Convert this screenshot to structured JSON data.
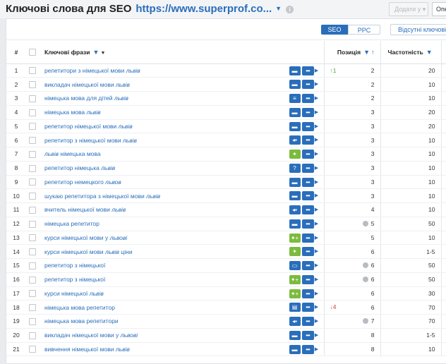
{
  "header": {
    "title": "Ключові слова для SEO",
    "url": "https://www.superprof.co...",
    "add_button": "Додати у",
    "ope_button": "Опе"
  },
  "toolbar": {
    "seo": "SEO",
    "ppc": "PPC",
    "hidden_button": "Відсутні ключові с"
  },
  "columns": {
    "num": "#",
    "keyword": "Ключові фрази",
    "position": "Позиція",
    "frequency": "Частотність"
  },
  "rows": [
    {
      "n": "1",
      "pre": "репетитори з німецької мови ",
      "it": "львів",
      "post": "",
      "i1": "chat",
      "c1": "blue",
      "tr": "↑1",
      "tc": "up",
      "dot": false,
      "pos": "2",
      "freq": "20"
    },
    {
      "n": "2",
      "pre": "викладач німецької мови ",
      "it": "львів",
      "post": "",
      "i1": "chat",
      "c1": "blue",
      "tr": "",
      "tc": "",
      "dot": false,
      "pos": "2",
      "freq": "10"
    },
    {
      "n": "3",
      "pre": "німецька мова для дітей ",
      "it": "львів",
      "post": "",
      "i1": "list",
      "c1": "blue",
      "tr": "",
      "tc": "",
      "dot": false,
      "pos": "2",
      "freq": "10"
    },
    {
      "n": "4",
      "pre": "німецька мова ",
      "it": "львів",
      "post": "",
      "i1": "chat",
      "c1": "blue",
      "tr": "",
      "tc": "",
      "dot": false,
      "pos": "3",
      "freq": "20"
    },
    {
      "n": "5",
      "pre": "репетитор німецької мови ",
      "it": "львів",
      "post": "",
      "i1": "chat",
      "c1": "blue",
      "tr": "",
      "tc": "",
      "dot": false,
      "pos": "3",
      "freq": "20"
    },
    {
      "n": "6",
      "pre": "репетитор з німецької мови ",
      "it": "львів",
      "post": "",
      "i1": "sign",
      "c1": "blue",
      "tr": "",
      "tc": "",
      "dot": false,
      "pos": "3",
      "freq": "10"
    },
    {
      "n": "7",
      "pre": "",
      "it": "львів",
      "post": " німецька мова",
      "i1": "sparkle",
      "c1": "green",
      "tr": "",
      "tc": "",
      "dot": false,
      "pos": "3",
      "freq": "10"
    },
    {
      "n": "8",
      "pre": "репетитор німецька ",
      "it": "львів",
      "post": "",
      "i1": "question",
      "c1": "blue",
      "tr": "",
      "tc": "",
      "dot": false,
      "pos": "3",
      "freq": "10"
    },
    {
      "n": "9",
      "pre": "репетитор немецкого ",
      "it": "львов",
      "post": "",
      "i1": "chat",
      "c1": "blue",
      "tr": "",
      "tc": "",
      "dot": false,
      "pos": "3",
      "freq": "10"
    },
    {
      "n": "10",
      "pre": "шукаю репетитора з німецької мови ",
      "it": "львів",
      "post": "",
      "i1": "chat",
      "c1": "blue",
      "tr": "",
      "tc": "",
      "dot": false,
      "pos": "3",
      "freq": "10"
    },
    {
      "n": "11",
      "pre": "вчитель німецької мови ",
      "it": "львів",
      "post": "",
      "i1": "sign",
      "c1": "blue",
      "tr": "",
      "tc": "",
      "dot": false,
      "pos": "4",
      "freq": "10"
    },
    {
      "n": "12",
      "pre": "німецька репетитор",
      "it": "",
      "post": "",
      "i1": "chat",
      "c1": "blue",
      "tr": "",
      "tc": "",
      "dot": true,
      "pos": "5",
      "freq": "50"
    },
    {
      "n": "13",
      "pre": "курси німецької мови у ",
      "it": "львові",
      "post": "",
      "i1": "sparkles",
      "c1": "green",
      "tr": "",
      "tc": "",
      "dot": false,
      "pos": "5",
      "freq": "10"
    },
    {
      "n": "14",
      "pre": "курси німецької мови ",
      "it": "львів",
      "post": " ціни",
      "i1": "sparkle",
      "c1": "green",
      "tr": "",
      "tc": "",
      "dot": false,
      "pos": "6",
      "freq": "1-5"
    },
    {
      "n": "15",
      "pre": "репетитор з німецької",
      "it": "",
      "post": "",
      "i1": "card",
      "c1": "blue",
      "tr": "",
      "tc": "",
      "dot": true,
      "pos": "6",
      "freq": "50"
    },
    {
      "n": "16",
      "pre": "репетитор з німецької",
      "it": "",
      "post": "",
      "i1": "sparkles",
      "c1": "green",
      "tr": "",
      "tc": "",
      "dot": true,
      "pos": "6",
      "freq": "50"
    },
    {
      "n": "17",
      "pre": "курси німецької ",
      "it": "львів",
      "post": "",
      "i1": "sparkles",
      "c1": "green",
      "tr": "",
      "tc": "",
      "dot": false,
      "pos": "6",
      "freq": "30"
    },
    {
      "n": "18",
      "pre": "німецька мова репетитор",
      "it": "",
      "post": "",
      "i1": "image",
      "c1": "blue",
      "tr": "↓4",
      "tc": "down",
      "dot": false,
      "pos": "6",
      "freq": "70"
    },
    {
      "n": "19",
      "pre": "німецька мова репетитори",
      "it": "",
      "post": "",
      "i1": "sign",
      "c1": "blue",
      "tr": "",
      "tc": "",
      "dot": true,
      "pos": "7",
      "freq": "70"
    },
    {
      "n": "20",
      "pre": "викладач німецької мови у ",
      "it": "львові",
      "post": "",
      "i1": "chat",
      "c1": "blue",
      "tr": "",
      "tc": "",
      "dot": false,
      "pos": "8",
      "freq": "1-5"
    },
    {
      "n": "21",
      "pre": "вивчення німецької мови ",
      "it": "львів",
      "post": "",
      "i1": "chat",
      "c1": "blue",
      "tr": "",
      "tc": "",
      "dot": false,
      "pos": "8",
      "freq": "10"
    }
  ]
}
